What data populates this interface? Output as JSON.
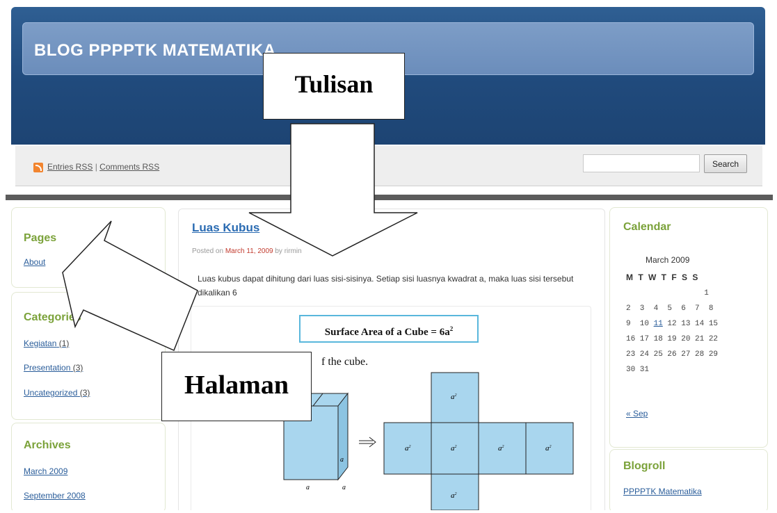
{
  "site": {
    "title": "BLOG PPPPTK MATEMATIKA"
  },
  "feeds": {
    "entries": "Entries RSS",
    "separator": "|",
    "comments": "Comments RSS"
  },
  "search": {
    "button": "Search",
    "value": ""
  },
  "pages": {
    "title": "Pages",
    "items": [
      {
        "label": "About"
      }
    ]
  },
  "categories": {
    "title": "Categories",
    "items": [
      {
        "label": "Kegiatan",
        "count": "(1)"
      },
      {
        "label": "Presentation",
        "count": "(3)"
      },
      {
        "label": "Uncategorized",
        "count": "(3)"
      }
    ]
  },
  "archives": {
    "title": "Archives",
    "items": [
      {
        "label": "March 2009"
      },
      {
        "label": "September 2008"
      }
    ]
  },
  "post": {
    "title": "Luas Kubus",
    "meta_prefix": "Posted on",
    "date": "March 11, 2009",
    "meta_by": "by",
    "author": "rirmin",
    "body": "Luas kubus dapat dihitung dari luas sisi-sisinya. Setiap sisi luasnya kwadrat a, maka luas sisi tersebut dikalikan 6",
    "formula_text": "Surface Area of a Cube = 6a",
    "formula_exp": "2",
    "figure_caption": "f the cube.",
    "face_label": "a",
    "face_exp": "2",
    "edge_label": "a"
  },
  "calendar": {
    "title": "Calendar",
    "month": "March 2009",
    "days_header": "M T W T F S S",
    "rows": [
      "                 1",
      "2  3  4  5  6  7  8",
      "9  10 ",
      "16 17 18 19 20 21 22",
      "23 24 25 26 27 28 29",
      "30 31"
    ],
    "linked_day": "11",
    "row3_rest": " 12 13 14 15",
    "prev": "« Sep"
  },
  "blogroll": {
    "title": "Blogroll",
    "items": [
      {
        "label": "PPPPTK Matematika"
      }
    ]
  },
  "annotations": {
    "tulisan": "Tulisan",
    "halaman": "Halaman"
  },
  "colors": {
    "header": "#204a7c",
    "accent_green": "#7ba23a",
    "link_blue": "#2a5d9a",
    "cube_fill": "#a9d6ee"
  }
}
